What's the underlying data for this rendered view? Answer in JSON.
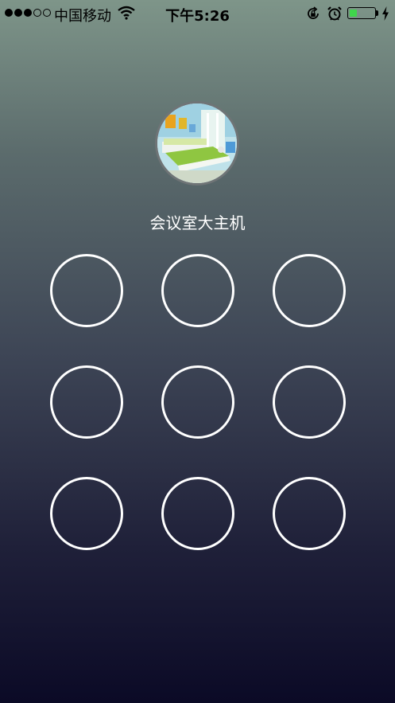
{
  "status_bar": {
    "signal_full": 3,
    "signal_empty": 2,
    "carrier": "中国移动",
    "time": "下午5:26",
    "battery_level": 0.3,
    "icons": [
      "wifi-icon",
      "rotation-lock-icon",
      "alarm-icon",
      "battery-icon",
      "charging-icon"
    ]
  },
  "device": {
    "name": "会议室大主机",
    "avatar_icon": "room-photo-avatar"
  },
  "pattern_lock": {
    "rows": 3,
    "columns": 3,
    "selected": []
  },
  "colors": {
    "gradient_top": "#7e9589",
    "gradient_bottom": "#0b0a26",
    "node_stroke": "#ffffff",
    "battery_fill": "#3fd64b"
  }
}
